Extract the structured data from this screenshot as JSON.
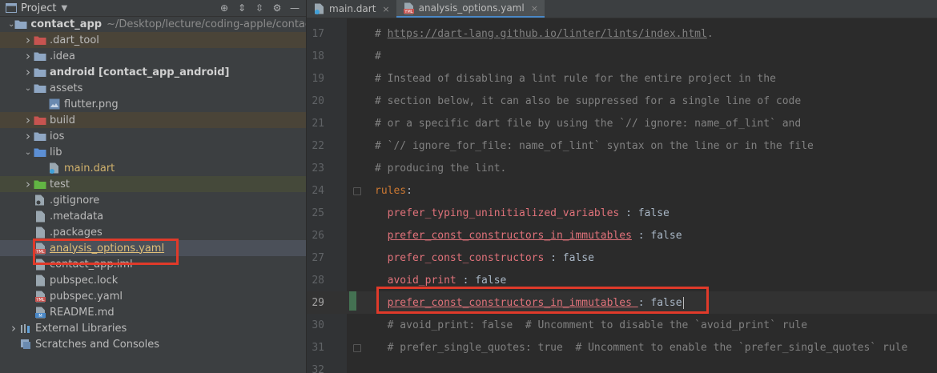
{
  "project_panel": {
    "title": "Project",
    "tree": [
      {
        "label": "contact_app",
        "path": "~/Desktop/lecture/coding-apple/contact",
        "depth": 0,
        "expanded": true,
        "icon": "folder-icon",
        "style": "bold"
      },
      {
        "label": ".dart_tool",
        "depth": 1,
        "expanded": false,
        "icon": "folder-red-icon",
        "style": "excluded"
      },
      {
        "label": ".idea",
        "depth": 1,
        "expanded": false,
        "icon": "folder-icon"
      },
      {
        "label": "android [contact_app_android]",
        "depth": 1,
        "expanded": false,
        "icon": "folder-icon",
        "style": "bold"
      },
      {
        "label": "assets",
        "depth": 1,
        "expanded": true,
        "icon": "folder-icon"
      },
      {
        "label": "flutter.png",
        "depth": 2,
        "icon": "image-icon"
      },
      {
        "label": "build",
        "depth": 1,
        "expanded": false,
        "icon": "folder-red-icon",
        "style": "excluded"
      },
      {
        "label": "ios",
        "depth": 1,
        "expanded": false,
        "icon": "folder-icon"
      },
      {
        "label": "lib",
        "depth": 1,
        "expanded": true,
        "icon": "folder-blue-icon"
      },
      {
        "label": "main.dart",
        "depth": 2,
        "icon": "dart-file-icon",
        "style": "orange"
      },
      {
        "label": "test",
        "depth": 1,
        "expanded": false,
        "icon": "folder-green-icon",
        "style": "test"
      },
      {
        "label": ".gitignore",
        "depth": 1,
        "icon": "gitignore-icon"
      },
      {
        "label": ".metadata",
        "depth": 1,
        "icon": "file-icon"
      },
      {
        "label": ".packages",
        "depth": 1,
        "icon": "file-icon"
      },
      {
        "label": "analysis_options.yaml",
        "depth": 1,
        "icon": "yaml-icon",
        "style": "selected"
      },
      {
        "label": "contact_app.iml",
        "depth": 1,
        "icon": "iml-icon"
      },
      {
        "label": "pubspec.lock",
        "depth": 1,
        "icon": "file-icon"
      },
      {
        "label": "pubspec.yaml",
        "depth": 1,
        "icon": "yaml-icon"
      },
      {
        "label": "README.md",
        "depth": 1,
        "icon": "markdown-icon"
      },
      {
        "label": "External Libraries",
        "depth": 0,
        "expanded": false,
        "icon": "libraries-icon"
      },
      {
        "label": "Scratches and Consoles",
        "depth": 0,
        "icon": "scratches-icon"
      }
    ]
  },
  "tabs": [
    {
      "label": "main.dart",
      "icon": "dart-file-icon",
      "active": false
    },
    {
      "label": "analysis_options.yaml",
      "icon": "yaml-icon",
      "active": true
    }
  ],
  "editor": {
    "lines": [
      {
        "num": "17",
        "parts": [
          [
            "cmt",
            "# "
          ],
          [
            "lnk",
            "https://dart-lang.github.io/linter/lints/index.html"
          ],
          [
            "cmt",
            "."
          ]
        ]
      },
      {
        "num": "18",
        "parts": [
          [
            "cmt",
            "#"
          ]
        ]
      },
      {
        "num": "19",
        "parts": [
          [
            "cmt",
            "# Instead of disabling a lint rule for the entire project in the"
          ]
        ]
      },
      {
        "num": "20",
        "parts": [
          [
            "cmt",
            "# section below, it can also be suppressed for a single line of code"
          ]
        ]
      },
      {
        "num": "21",
        "parts": [
          [
            "cmt",
            "# or a specific dart file by using the `// ignore: name_of_lint` and"
          ]
        ]
      },
      {
        "num": "22",
        "parts": [
          [
            "cmt",
            "# `// ignore_for_file: name_of_lint` syntax on the line or in the file"
          ]
        ]
      },
      {
        "num": "23",
        "parts": [
          [
            "cmt",
            "# producing the lint."
          ]
        ]
      },
      {
        "num": "24",
        "parts": [
          [
            "key",
            "rules"
          ],
          [
            "val",
            ":"
          ]
        ],
        "fold": true
      },
      {
        "num": "25",
        "parts": [
          [
            "val",
            "  "
          ],
          [
            "rkey",
            "prefer_typing_uninitialized_variables"
          ],
          [
            "val",
            " : false"
          ]
        ]
      },
      {
        "num": "26",
        "parts": [
          [
            "val",
            "  "
          ],
          [
            "ukey",
            "prefer_const_constructors_in_immutables"
          ],
          [
            "val",
            " : false"
          ]
        ]
      },
      {
        "num": "27",
        "parts": [
          [
            "val",
            "  "
          ],
          [
            "rkey",
            "prefer_const_constructors"
          ],
          [
            "val",
            " : false"
          ]
        ]
      },
      {
        "num": "28",
        "parts": [
          [
            "val",
            "  "
          ],
          [
            "rkey",
            "avoid_print"
          ],
          [
            "val",
            " : false"
          ]
        ]
      },
      {
        "num": "29",
        "parts": [
          [
            "val",
            "  "
          ],
          [
            "ukey",
            "prefer_const_constructors_in_immutables "
          ],
          [
            "val",
            ": false"
          ]
        ],
        "current": true,
        "changed": true
      },
      {
        "num": "30",
        "parts": [
          [
            "cmt",
            "  # avoid_print: false  # Uncomment to disable the `avoid_print` rule"
          ]
        ]
      },
      {
        "num": "31",
        "parts": [
          [
            "cmt",
            "  # prefer_single_quotes: true  # Uncomment to enable the `prefer_single_quotes` rule"
          ]
        ],
        "fold": true
      },
      {
        "num": "32",
        "parts": []
      }
    ]
  },
  "colors": {
    "highlight_box": "#e03a2a",
    "accent": "#4a88c7"
  }
}
